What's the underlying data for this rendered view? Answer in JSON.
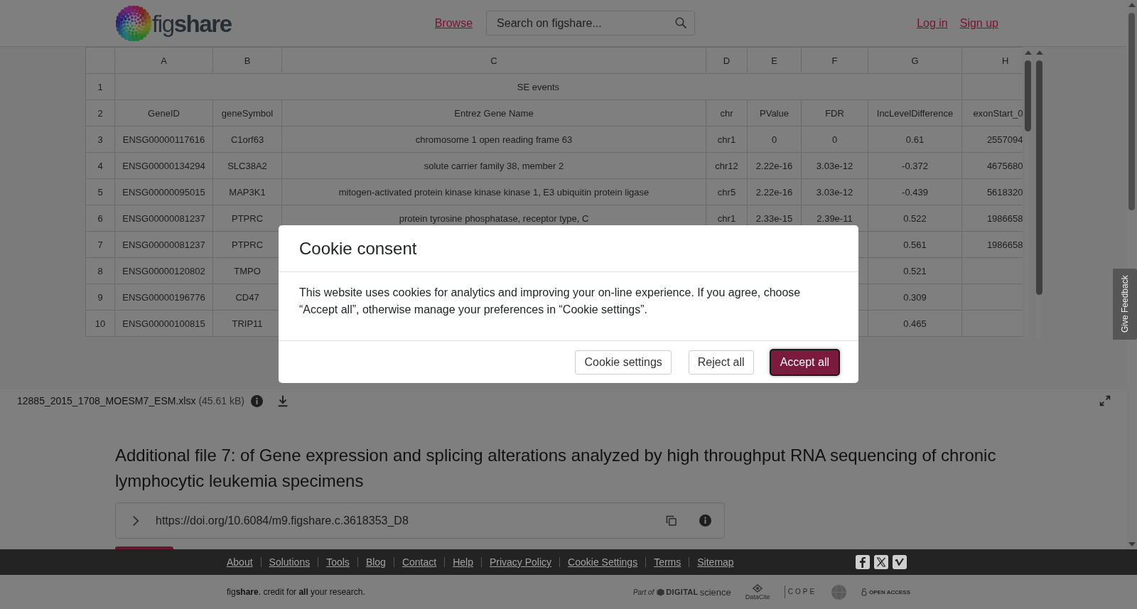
{
  "header": {
    "logo": "fig**share**",
    "nav_link": "Browse",
    "search": {
      "placeholder": "Search on figshare..."
    },
    "auth_links": [
      "Log in",
      "Sign up"
    ]
  },
  "preview": {
    "columns": [
      "A",
      "B",
      "C",
      "D",
      "E",
      "F",
      "G",
      "H"
    ],
    "rows": [
      {
        "number": "1",
        "kind": "title",
        "text": "SE events"
      },
      {
        "number": "2",
        "kind": "data",
        "cells": [
          "GeneID",
          "geneSymbol",
          "Entrez Gene Name",
          "chr",
          "PValue",
          "FDR",
          "IncLevelDifference",
          "exonStart_0"
        ]
      },
      {
        "number": "3",
        "kind": "data",
        "cells": [
          "ENSG00000117616",
          "C1orf63",
          "chromosome 1 open reading frame 63",
          "chr1",
          "0",
          "0",
          "0.61",
          "2557094"
        ]
      },
      {
        "number": "4",
        "kind": "data",
        "cells": [
          "ENSG00000134294",
          "SLC38A2",
          "solute carrier family 38, member 2",
          "chr12",
          "2.22e-16",
          "3.03e-12",
          "-0.372",
          "4675680"
        ]
      },
      {
        "number": "5",
        "kind": "data",
        "cells": [
          "ENSG00000095015",
          "MAP3K1",
          "mitogen-activated protein kinase kinase kinase 1, E3 ubiquitin protein ligase",
          "chr5",
          "2.22e-16",
          "3.03e-12",
          "-0.439",
          "5618320"
        ]
      },
      {
        "number": "6",
        "kind": "data",
        "cells": [
          "ENSG00000081237",
          "PTPRC",
          "protein tyrosine phosphatase, receptor type, C",
          "chr1",
          "2.33e-15",
          "2.39e-11",
          "0.522",
          "1986658"
        ]
      },
      {
        "number": "7",
        "kind": "data",
        "cells": [
          "ENSG00000081237",
          "PTPRC",
          null,
          null,
          null,
          null,
          "0.561",
          "1986658"
        ]
      },
      {
        "number": "8",
        "kind": "data",
        "cells": [
          "ENSG00000120802",
          "TMPO",
          null,
          null,
          null,
          null,
          "0.521",
          null
        ]
      },
      {
        "number": "9",
        "kind": "data",
        "cells": [
          "ENSG00000196776",
          "CD47",
          null,
          null,
          null,
          null,
          "0.309",
          null
        ]
      },
      {
        "number": "10",
        "kind": "data",
        "cells": [
          "ENSG00000100815",
          "TRIP11",
          null,
          null,
          null,
          null,
          "0.465",
          null
        ]
      }
    ],
    "file": {
      "name": "12885_2015_1708_MOESM7_ESM.xlsx",
      "size": "(45.61 kB)"
    }
  },
  "article": {
    "title": "Additional file 7: of Gene expression and splicing alterations analyzed by high throughput RNA sequencing of chronic lymphocytic leukemia specimens",
    "doi": "https://doi.org/10.6084/m9.figshare.c.3618353_D8"
  },
  "footer": {
    "links": [
      "About",
      "Solutions",
      "Tools",
      "Blog",
      "Contact",
      "Help",
      "Privacy Policy",
      "Cookie Settings",
      "Terms",
      "Sitemap"
    ],
    "tagline": "fig**share**. credit for **all** your research.",
    "partners": [
      {
        "kind": "digital_science",
        "label": "Part of",
        "name": "DIGITAL",
        "suffix": "science"
      },
      {
        "kind": "datacite",
        "label": "DataCite"
      },
      {
        "kind": "cope",
        "label": "COPE"
      },
      {
        "kind": "globe"
      },
      {
        "kind": "open_access",
        "label": "OPEN ACCESS"
      }
    ]
  },
  "feedback_tab": "Give Feedback",
  "cookie_dialog": {
    "title": "Cookie consent",
    "body": "This website uses cookies for analytics and improving your on-line experience. If you agree, choose “Accept all”, otherwise manage your preferences in “Cookie settings”.",
    "buttons": [
      {
        "label": "Cookie settings",
        "kind": "secondary",
        "focused": false
      },
      {
        "label": "Reject all",
        "kind": "secondary",
        "focused": false
      },
      {
        "label": "Accept all",
        "kind": "primary",
        "focused": true
      }
    ]
  }
}
